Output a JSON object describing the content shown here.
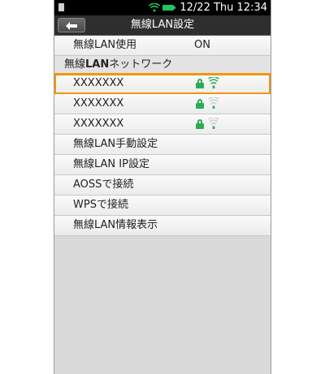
{
  "status_bar": {
    "datetime": "12/22 Thu 12:34",
    "battery_color": "#22c55e",
    "wifi_color": "#22c55e"
  },
  "title_bar": {
    "back_icon": "back-arrow-icon",
    "title": "無線LAN設定"
  },
  "wlan_use": {
    "label": "無線LAN使用",
    "value": "ON"
  },
  "section": {
    "prefix": "無線",
    "bold": "LAN",
    "suffix": "ネットワーク"
  },
  "networks": [
    {
      "ssid": "XXXXXXX",
      "secured": true,
      "signal": "strong"
    },
    {
      "ssid": "XXXXXXX",
      "secured": true,
      "signal": "weak"
    },
    {
      "ssid": "XXXXXXX",
      "secured": true,
      "signal": "weak"
    }
  ],
  "menu": [
    {
      "label": "無線LAN手動設定"
    },
    {
      "label": "無線LAN IP設定"
    },
    {
      "label": "AOSSで接続"
    },
    {
      "label": "WPSで接続"
    },
    {
      "label": "無線LAN情報表示"
    }
  ],
  "colors": {
    "highlight": "#f0960f",
    "secure_icon": "#2eab57"
  }
}
